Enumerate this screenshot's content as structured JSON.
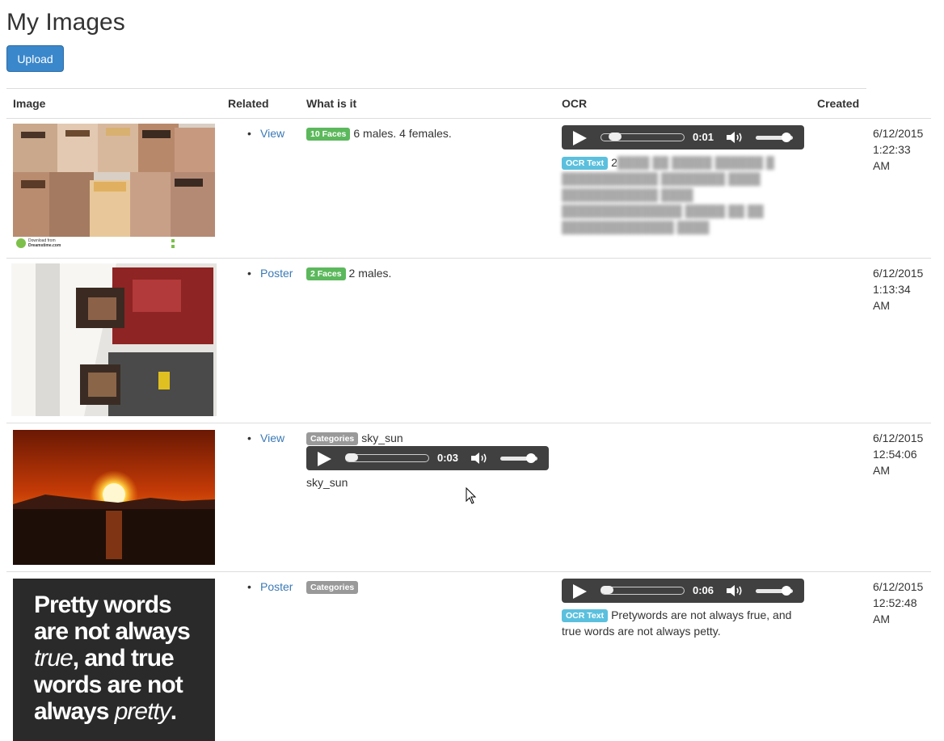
{
  "page": {
    "title": "My Images",
    "upload_label": "Upload"
  },
  "table": {
    "headers": {
      "image": "Image",
      "related": "Related",
      "what": "What is it",
      "ocr": "OCR",
      "created": "Created"
    }
  },
  "rows": [
    {
      "related": "View",
      "badge": "10 Faces",
      "what_text": "6 males. 4 females.",
      "audio_time": "0:01",
      "ocr_badge": "OCR Text",
      "ocr_text": "2",
      "created": [
        "6/12/2015",
        "1:22:33",
        "AM"
      ],
      "thumb_lines": [
        "Download from",
        "Dreamstime.com"
      ]
    },
    {
      "related": "Poster",
      "badge": "2 Faces",
      "what_text": "2 males.",
      "created": [
        "6/12/2015",
        "1:13:34",
        "AM"
      ]
    },
    {
      "related": "View",
      "badge": "Categories",
      "what_text": "sky_sun",
      "audio_time": "0:03",
      "caption": "sky_sun",
      "created": [
        "6/12/2015",
        "12:54:06",
        "AM"
      ]
    },
    {
      "related": "Poster",
      "badge": "Categories",
      "audio_time": "0:06",
      "ocr_badge": "OCR Text",
      "ocr_text": "Pretywords are not always frue, and true words are not always petty.",
      "created": [
        "6/12/2015",
        "12:52:48",
        "AM"
      ],
      "poster_lines": [
        "Pretty words",
        "are not always",
        "true, and true",
        "words are not",
        "always pretty."
      ]
    }
  ],
  "colors": {
    "link": "#3a7ab7",
    "upload_button": "#3a87cb",
    "badge_green": "#5cb85c",
    "badge_gray": "#999999",
    "badge_cyan": "#5bc0de",
    "audio_bg": "#404040"
  }
}
